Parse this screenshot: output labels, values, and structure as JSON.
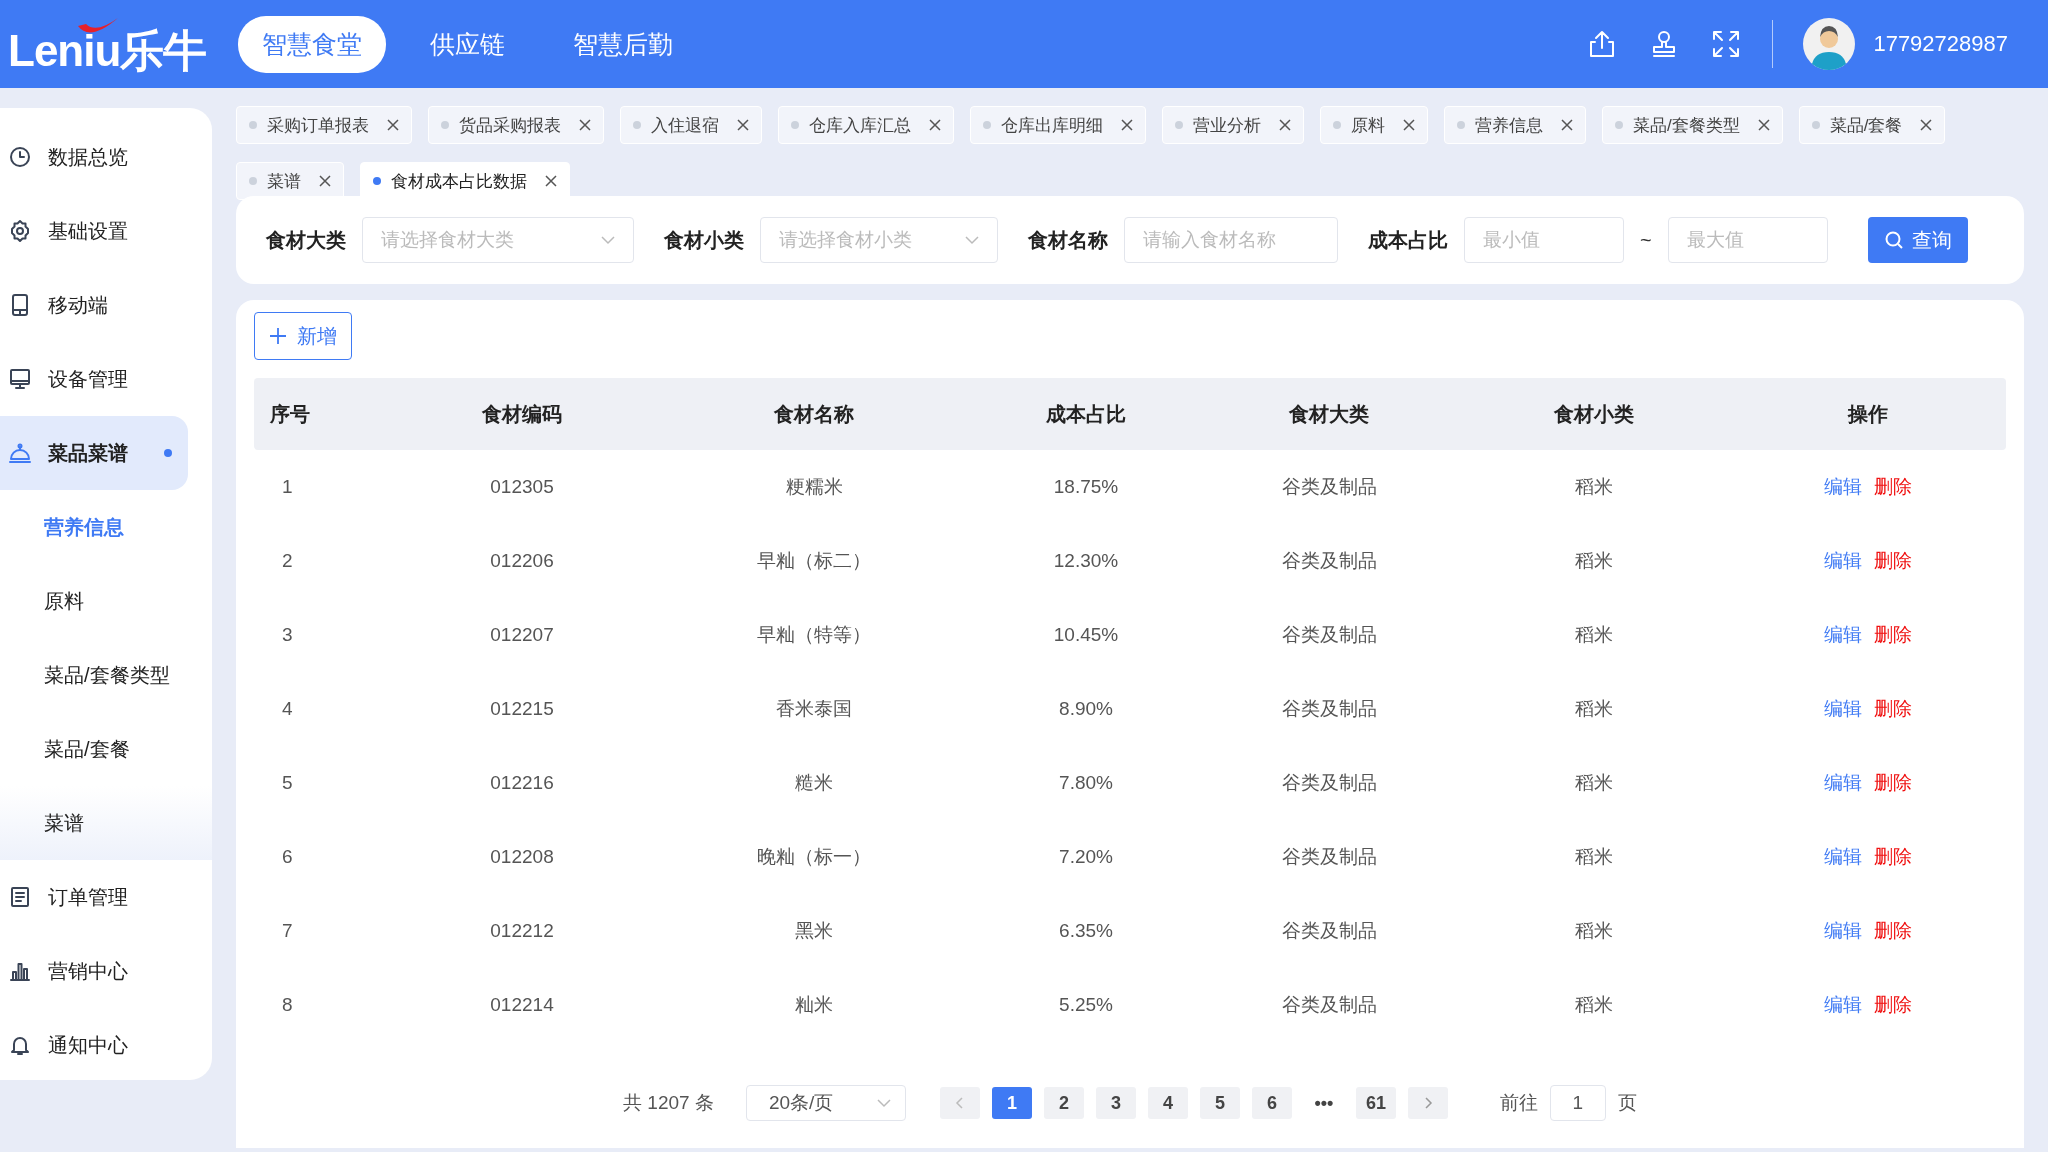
{
  "header": {
    "logo": "Leniu乐牛",
    "nav": [
      {
        "label": "智慧食堂",
        "selected": true
      },
      {
        "label": "供应链",
        "selected": false
      },
      {
        "label": "智慧后勤",
        "selected": false
      }
    ],
    "user": {
      "phone": "17792728987"
    }
  },
  "sidebar": {
    "items": [
      {
        "label": "数据总览",
        "selected": false
      },
      {
        "label": "基础设置",
        "selected": false
      },
      {
        "label": "移动端",
        "selected": false
      },
      {
        "label": "设备管理",
        "selected": false
      },
      {
        "label": "菜品菜谱",
        "selected": true,
        "children": [
          {
            "label": "营养信息",
            "selected": true
          },
          {
            "label": "原料",
            "selected": false
          },
          {
            "label": "菜品/套餐类型",
            "selected": false
          },
          {
            "label": "菜品/套餐",
            "selected": false
          },
          {
            "label": "菜谱",
            "selected": false
          }
        ]
      },
      {
        "label": "订单管理",
        "selected": false
      },
      {
        "label": "营销中心",
        "selected": false
      },
      {
        "label": "通知中心",
        "selected": false
      }
    ]
  },
  "tabs": [
    {
      "label": "采购订单报表",
      "selected": false
    },
    {
      "label": "货品采购报表",
      "selected": false
    },
    {
      "label": "入住退宿",
      "selected": false
    },
    {
      "label": "仓库入库汇总",
      "selected": false
    },
    {
      "label": "仓库出库明细",
      "selected": false
    },
    {
      "label": "营业分析",
      "selected": false
    },
    {
      "label": "原料",
      "selected": false
    },
    {
      "label": "营养信息",
      "selected": false
    },
    {
      "label": "菜品/套餐类型",
      "selected": false
    },
    {
      "label": "菜品/套餐",
      "selected": false
    },
    {
      "label": "菜谱",
      "selected": false
    },
    {
      "label": "食材成本占比数据",
      "selected": true
    }
  ],
  "filters": [
    {
      "kind": "select",
      "label": "食材大类",
      "placeholder": "请选择食材大类"
    },
    {
      "kind": "select",
      "label": "食材小类",
      "placeholder": "请选择食材小类"
    },
    {
      "kind": "input",
      "label": "食材名称",
      "placeholder": "请输入食材名称"
    },
    {
      "kind": "range",
      "label": "成本占比",
      "min_placeholder": "最小值",
      "separator": "~",
      "max_placeholder": "最大值"
    }
  ],
  "search_button": "查询",
  "add_button": "新增",
  "table": {
    "columns": [
      "序号",
      "食材编码",
      "食材名称",
      "成本占比",
      "食材大类",
      "食材小类",
      "操作"
    ],
    "rows": [
      {
        "cells": [
          "1",
          "012305",
          "粳糯米",
          "18.75%",
          "谷类及制品",
          "稻米"
        ],
        "edit": "编辑",
        "delete": "删除"
      },
      {
        "cells": [
          "2",
          "012206",
          "早籼（标二）",
          "12.30%",
          "谷类及制品",
          "稻米"
        ],
        "edit": "编辑",
        "delete": "删除"
      },
      {
        "cells": [
          "3",
          "012207",
          "早籼（特等）",
          "10.45%",
          "谷类及制品",
          "稻米"
        ],
        "edit": "编辑",
        "delete": "删除"
      },
      {
        "cells": [
          "4",
          "012215",
          "香米泰国",
          "8.90%",
          "谷类及制品",
          "稻米"
        ],
        "edit": "编辑",
        "delete": "删除"
      },
      {
        "cells": [
          "5",
          "012216",
          "糙米",
          "7.80%",
          "谷类及制品",
          "稻米"
        ],
        "edit": "编辑",
        "delete": "删除"
      },
      {
        "cells": [
          "6",
          "012208",
          "晚籼（标一）",
          "7.20%",
          "谷类及制品",
          "稻米"
        ],
        "edit": "编辑",
        "delete": "删除"
      },
      {
        "cells": [
          "7",
          "012212",
          "黑米",
          "6.35%",
          "谷类及制品",
          "稻米"
        ],
        "edit": "编辑",
        "delete": "删除"
      },
      {
        "cells": [
          "8",
          "012214",
          "籼米",
          "5.25%",
          "谷类及制品",
          "稻米"
        ],
        "edit": "编辑",
        "delete": "删除"
      }
    ]
  },
  "pagination": {
    "total": "共 1207 条",
    "page_size": "20条/页",
    "pages": [
      {
        "label": "1",
        "selected": true
      },
      {
        "label": "2",
        "selected": false
      },
      {
        "label": "3",
        "selected": false
      },
      {
        "label": "4",
        "selected": false
      },
      {
        "label": "5",
        "selected": false
      },
      {
        "label": "6",
        "selected": false
      },
      {
        "label": "•••",
        "selected": false
      },
      {
        "label": "61",
        "selected": false
      }
    ],
    "goto_label": "前往",
    "goto_value": "1",
    "page_unit": "页"
  }
}
